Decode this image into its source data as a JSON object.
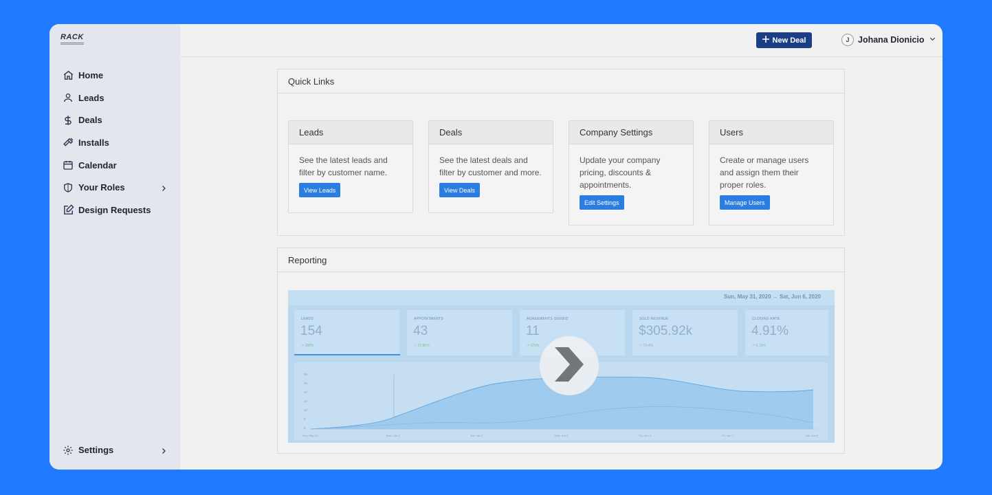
{
  "brand": {
    "logo_text": "RACK"
  },
  "sidebar": {
    "items": [
      {
        "label": "Home",
        "icon": "home-icon"
      },
      {
        "label": "Leads",
        "icon": "user-icon"
      },
      {
        "label": "Deals",
        "icon": "dollar-icon"
      },
      {
        "label": "Installs",
        "icon": "hammer-icon"
      },
      {
        "label": "Calendar",
        "icon": "calendar-icon"
      },
      {
        "label": "Your Roles",
        "icon": "shield-icon"
      },
      {
        "label": "Design Requests",
        "icon": "edit-icon"
      }
    ],
    "settings_label": "Settings"
  },
  "topbar": {
    "new_deal_label": "New Deal",
    "user_initial": "J",
    "user_name": "Johana Dionicio"
  },
  "quick_links": {
    "title": "Quick Links",
    "cards": [
      {
        "title": "Leads",
        "text": "See the latest leads and filter by customer name.",
        "button": "View Leads"
      },
      {
        "title": "Deals",
        "text": "See the latest deals and filter by customer and more.",
        "button": "View Deals"
      },
      {
        "title": "Company Settings",
        "text": "Update your company pricing, discounts & appointments.",
        "button": "Edit Settings"
      },
      {
        "title": "Users",
        "text": "Create or manage users and assign them their proper roles.",
        "button": "Manage Users"
      }
    ]
  },
  "reporting": {
    "title": "Reporting",
    "video": {
      "date_range": "Sun, May 31, 2020  →  Sat, Jun 6, 2020",
      "stats": [
        {
          "label": "LEADS",
          "value": "154",
          "change": "↗ 288%"
        },
        {
          "label": "APPOINTMENTS",
          "value": "43",
          "change": "↗ 22.86%"
        },
        {
          "label": "AGREEMENTS SIGNED",
          "value": "11",
          "change": "↗ 175%"
        },
        {
          "label": "SOLD REVENUE",
          "value": "$305.92k",
          "change": "↗ 70.4%"
        },
        {
          "label": "CLOSING RATE",
          "value": "4.91%",
          "change": "↗ 6.15%"
        }
      ],
      "x_labels": [
        "Sun, May 31",
        "Mon, Jun 1",
        "Tue, Jun 2",
        "Wed, Jun 3",
        "Thu, Jun 4",
        "Fri, Jun 5",
        "Sat, Jun 6"
      ],
      "y_labels": [
        "30",
        "25",
        "20",
        "15",
        "10",
        "5",
        "0"
      ]
    }
  },
  "colors": {
    "background": "#1f7aff",
    "primary_button": "#1b3f85",
    "link_button": "#2b7de1"
  }
}
